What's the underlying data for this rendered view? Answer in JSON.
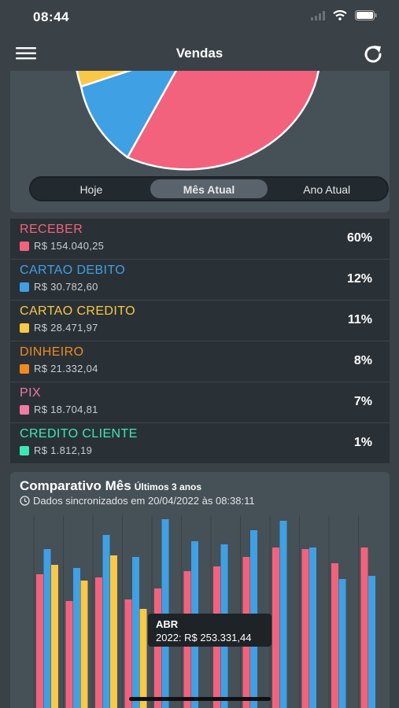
{
  "status": {
    "time": "08:44"
  },
  "nav": {
    "title": "Vendas"
  },
  "tabs": [
    {
      "label": "Hoje",
      "active": false
    },
    {
      "label": "Mês Atual",
      "active": true
    },
    {
      "label": "Ano Atual",
      "active": false
    }
  ],
  "colors": {
    "pink": "#f2627c",
    "blue": "#3fa0e4",
    "yellow": "#f8c846",
    "orange": "#f08a20",
    "rose": "#f07aa4",
    "green": "#3ee8b4"
  },
  "items": [
    {
      "name": "RECEBER",
      "value": "R$ 154.040,25",
      "pct": "60%",
      "color": "#f2627c"
    },
    {
      "name": "CARTAO DEBITO",
      "value": "R$ 30.782,60",
      "pct": "12%",
      "color": "#3fa0e4"
    },
    {
      "name": "CARTAO CREDITO",
      "value": "R$ 28.471,97",
      "pct": "11%",
      "color": "#f8c846"
    },
    {
      "name": "DINHEIRO",
      "value": "R$ 21.332,04",
      "pct": "8%",
      "color": "#f08a20"
    },
    {
      "name": "PIX",
      "value": "R$ 18.704,81",
      "pct": "7%",
      "color": "#f07aa4"
    },
    {
      "name": "CREDITO CLIENTE",
      "value": "R$ 1.812,19",
      "pct": "1%",
      "color": "#3ee8b4"
    }
  ],
  "comparativo": {
    "title": "Comparativo Mês",
    "subtitle": "Últimos 3 anos",
    "sync": "Dados sincronizados em 20/04/2022 às 08:38:11",
    "tooltip": {
      "month": "ABR",
      "value": "2022: R$ 253.331,44"
    }
  },
  "chart_data": {
    "type": "bar",
    "series": [
      {
        "values": [
          85,
          68,
          83,
          69,
          76,
          87,
          90,
          96,
          102,
          101,
          92,
          102
        ]
      },
      {
        "values": [
          101,
          89,
          110,
          96,
          120,
          106,
          104,
          113,
          119,
          102,
          82,
          84
        ]
      },
      {
        "values": [
          91,
          81,
          97,
          63
        ]
      }
    ]
  }
}
